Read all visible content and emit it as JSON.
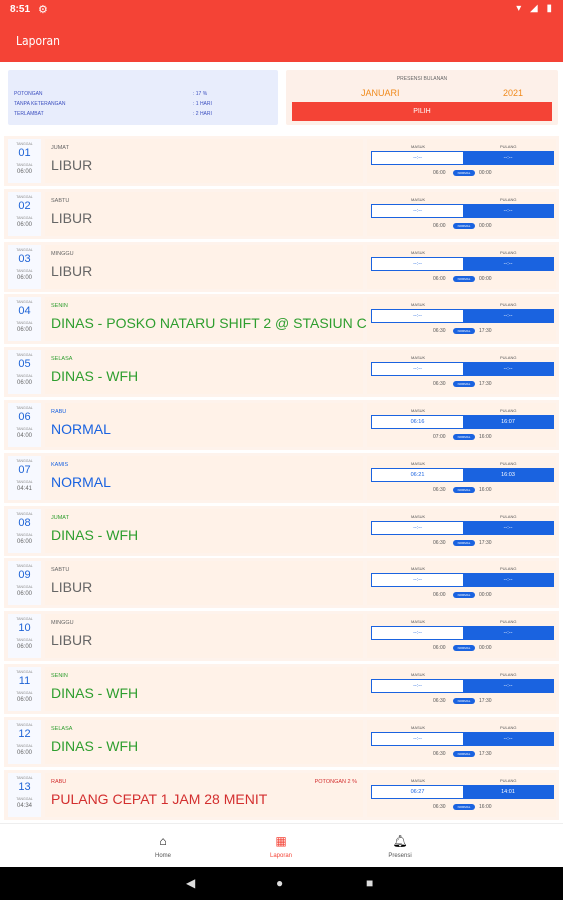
{
  "statusbar": {
    "time": "8:51",
    "settings_icon": "gear-icon",
    "icons": "wifi-icon signal-icon battery-icon"
  },
  "appbar": {
    "title": "Laporan"
  },
  "summary": {
    "rows": [
      {
        "label": "POTONGAN",
        "value": ": 17 %"
      },
      {
        "label": "TANPA KETERANGAN",
        "value": ": 1 HARI"
      },
      {
        "label": "TERLAMBAT",
        "value": ": 2 HARI"
      }
    ]
  },
  "presensi": {
    "label": "PRESENSI BULANAN",
    "month": "JANUARI",
    "year": "2021",
    "button": "PILIH"
  },
  "entries": [
    {
      "tl": "TANGGAL",
      "date": "01",
      "tl2": "TANGGAL",
      "time": "06:00",
      "day": "JUMAT",
      "status": "LIBUR",
      "status_color": "grey",
      "masuk_label": "MASUK",
      "pulang_label": "PULANG",
      "masuk": "--:--",
      "pulang": "--:--",
      "t1": "06:00",
      "badge": "NORMAL",
      "t2": "00:00"
    },
    {
      "tl": "TANGGAL",
      "date": "02",
      "tl2": "TANGGAL",
      "time": "06:00",
      "day": "SABTU",
      "status": "LIBUR",
      "status_color": "grey",
      "masuk_label": "MASUK",
      "pulang_label": "PULANG",
      "masuk": "--:--",
      "pulang": "--:--",
      "t1": "06:00",
      "badge": "NORMAL",
      "t2": "00:00"
    },
    {
      "tl": "TANGGAL",
      "date": "03",
      "tl2": "TANGGAL",
      "time": "06:00",
      "day": "MINGGU",
      "status": "LIBUR",
      "status_color": "grey",
      "masuk_label": "MASUK",
      "pulang_label": "PULANG",
      "masuk": "--:--",
      "pulang": "--:--",
      "t1": "06:00",
      "badge": "NORMAL",
      "t2": "00:00"
    },
    {
      "tl": "TANGGAL",
      "date": "04",
      "tl2": "TANGGAL",
      "time": "06:00",
      "day": "SENIN",
      "status": "DINAS - POSKO NATARU SHIFT 2 @ STASIUN CITAYAM",
      "status_color": "green",
      "masuk_label": "MASUK",
      "pulang_label": "PULANG",
      "masuk": "--:--",
      "pulang": "--:--",
      "t1": "06:30",
      "badge": "NORMAL",
      "t2": "17:30"
    },
    {
      "tl": "TANGGAL",
      "date": "05",
      "tl2": "TANGGAL",
      "time": "06:00",
      "day": "SELASA",
      "status": "DINAS - WFH",
      "status_color": "green",
      "masuk_label": "MASUK",
      "pulang_label": "PULANG",
      "masuk": "--:--",
      "pulang": "--:--",
      "t1": "06:30",
      "badge": "NORMAL",
      "t2": "17:30"
    },
    {
      "tl": "TANGGAL",
      "date": "06",
      "tl2": "TANGGAL",
      "time": "04:00",
      "day": "RABU",
      "status": "NORMAL",
      "status_color": "blue",
      "masuk_label": "MASUK",
      "pulang_label": "PULANG",
      "masuk": "06:16",
      "pulang": "16:07",
      "t1": "07:00",
      "badge": "NORMAL",
      "t2": "16:00"
    },
    {
      "tl": "TANGGAL",
      "date": "07",
      "tl2": "TANGGAL",
      "time": "04:41",
      "day": "KAMIS",
      "status": "NORMAL",
      "status_color": "blue",
      "masuk_label": "MASUK",
      "pulang_label": "PULANG",
      "masuk": "06:21",
      "pulang": "16:03",
      "t1": "06:30",
      "badge": "NORMAL",
      "t2": "16:00"
    },
    {
      "tl": "TANGGAL",
      "date": "08",
      "tl2": "TANGGAL",
      "time": "06:00",
      "day": "JUMAT",
      "status": "DINAS - WFH",
      "status_color": "green",
      "masuk_label": "MASUK",
      "pulang_label": "PULANG",
      "masuk": "--:--",
      "pulang": "--:--",
      "t1": "06:30",
      "badge": "NORMAL",
      "t2": "17:30"
    },
    {
      "tl": "TANGGAL",
      "date": "09",
      "tl2": "TANGGAL",
      "time": "06:00",
      "day": "SABTU",
      "status": "LIBUR",
      "status_color": "grey",
      "masuk_label": "MASUK",
      "pulang_label": "PULANG",
      "masuk": "--:--",
      "pulang": "--:--",
      "t1": "06:00",
      "badge": "NORMAL",
      "t2": "00:00"
    },
    {
      "tl": "TANGGAL",
      "date": "10",
      "tl2": "TANGGAL",
      "time": "06:00",
      "day": "MINGGU",
      "status": "LIBUR",
      "status_color": "grey",
      "masuk_label": "MASUK",
      "pulang_label": "PULANG",
      "masuk": "--:--",
      "pulang": "--:--",
      "t1": "06:00",
      "badge": "NORMAL",
      "t2": "00:00"
    },
    {
      "tl": "TANGGAL",
      "date": "11",
      "tl2": "TANGGAL",
      "time": "06:00",
      "day": "SENIN",
      "status": "DINAS - WFH",
      "status_color": "green",
      "masuk_label": "MASUK",
      "pulang_label": "PULANG",
      "masuk": "--:--",
      "pulang": "--:--",
      "t1": "06:30",
      "badge": "NORMAL",
      "t2": "17:30"
    },
    {
      "tl": "TANGGAL",
      "date": "12",
      "tl2": "TANGGAL",
      "time": "06:00",
      "day": "SELASA",
      "status": "DINAS - WFH",
      "status_color": "green",
      "masuk_label": "MASUK",
      "pulang_label": "PULANG",
      "masuk": "--:--",
      "pulang": "--:--",
      "t1": "06:30",
      "badge": "NORMAL",
      "t2": "17:30"
    },
    {
      "tl": "TANGGAL",
      "date": "13",
      "tl2": "TANGGAL",
      "time": "04:34",
      "day": "RABU",
      "status": "PULANG CEPAT 1 JAM 28 MENIT",
      "status_color": "red",
      "potongan": "POTONGAN 2 %",
      "masuk_label": "MASUK",
      "pulang_label": "PULANG",
      "masuk": "06:27",
      "pulang": "14:01",
      "t1": "06:30",
      "badge": "NORMAL",
      "t2": "16:00"
    }
  ],
  "nav": {
    "items": [
      {
        "label": "Home",
        "icon": "home-icon"
      },
      {
        "label": "Laporan",
        "icon": "report-icon"
      },
      {
        "label": "Presensi",
        "icon": "bell-icon"
      }
    ]
  },
  "sysnav": {
    "back": "back-icon",
    "home": "home-circle-icon",
    "recents": "recents-icon"
  }
}
